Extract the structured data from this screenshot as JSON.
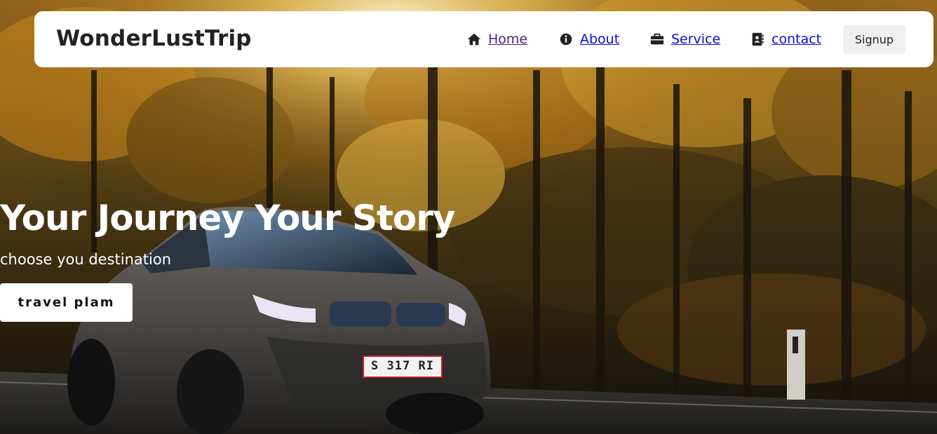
{
  "navbar": {
    "brand": "WonderLustTrip",
    "links": [
      {
        "label": "Home",
        "icon": "home-icon"
      },
      {
        "label": "About",
        "icon": "info-icon"
      },
      {
        "label": "Service",
        "icon": "briefcase-icon"
      },
      {
        "label": "contact",
        "icon": "contact-book-icon"
      }
    ],
    "signup_label": "Signup"
  },
  "hero": {
    "title": "Your Journey Your Story",
    "subtitle": "choose you destination",
    "cta_label": "travel plam",
    "background": "autumn-forest-road-with-car-photo",
    "plate_text": "S 317 RI"
  },
  "colors": {
    "link": "#0b0bd8",
    "link_visited": "#551a8b",
    "navbar_bg": "#ffffff",
    "signup_bg": "#efefef",
    "brand_text": "#222222"
  }
}
